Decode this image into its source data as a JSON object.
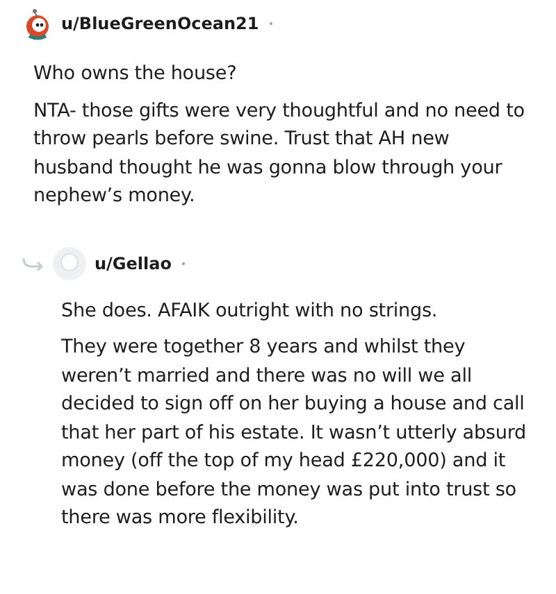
{
  "comments": [
    {
      "author": "u/BlueGreenOcean21",
      "kind": "top",
      "paragraphs": [
        "Who owns the house?",
        "NTA- those gifts were very thoughtful and no need to throw pearls before swine. Trust that AH new husband thought he was gonna blow through your nephew’s money."
      ]
    },
    {
      "author": "u/Gellao",
      "kind": "reply",
      "paragraphs": [
        "She does. AFAIK outright with no strings.",
        "They were together 8 years and whilst they weren’t married and there was no will we all decided to sign off on her buying a house and call that her part of his estate. It wasn’t utterly absurd money (off the top of my head £220,000) and it was done before the money was put into trust so there was more flexibility."
      ]
    }
  ]
}
